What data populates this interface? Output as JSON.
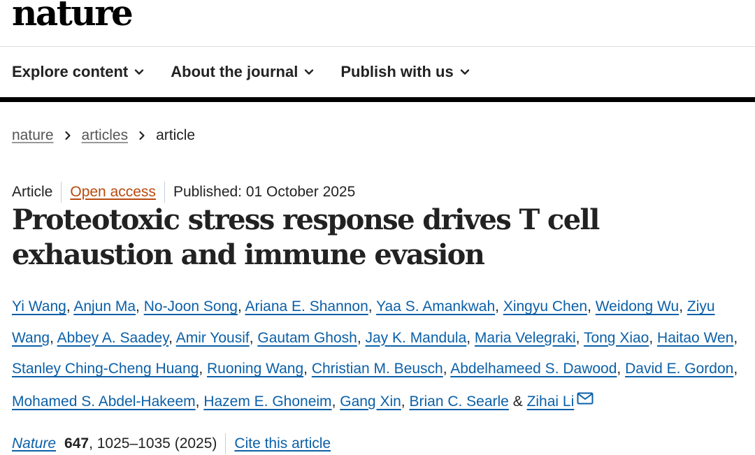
{
  "site": {
    "logo": "nature"
  },
  "nav": {
    "items": [
      {
        "label": "Explore content",
        "icon": "chevron-down-icon"
      },
      {
        "label": "About the journal",
        "icon": "chevron-down-icon"
      },
      {
        "label": "Publish with us",
        "icon": "chevron-down-icon"
      }
    ]
  },
  "breadcrumb": {
    "items": [
      "nature",
      "articles"
    ],
    "current": "article",
    "separator_icon": "chevron-right-icon"
  },
  "article": {
    "type": "Article",
    "access": "Open access",
    "published": "Published: 01 October 2025",
    "title": "Proteotoxic stress response drives T cell exhaustion and immune evasion",
    "authors": [
      "Yi Wang",
      "Anjun Ma",
      "No-Joon Song",
      "Ariana E. Shannon",
      "Yaa S. Amankwah",
      "Xingyu Chen",
      "Weidong Wu",
      "Ziyu Wang",
      "Abbey A. Saadey",
      "Amir Yousif",
      "Gautam Ghosh",
      "Jay K. Mandula",
      "Maria Velegraki",
      "Tong Xiao",
      "Haitao Wen",
      "Stanley Ching-Cheng Huang",
      "Ruoning Wang",
      "Christian M. Beusch",
      "Abdelhameed S. Dawood",
      "David E. Gordon",
      "Mohamed S. Abdel-Hakeem",
      "Hazem E. Ghoneim",
      "Gang Xin",
      "Brian C. Searle",
      "Zihai Li"
    ],
    "author_sep": ", ",
    "last_sep": " & ",
    "corresponding_icon": "mail-icon"
  },
  "citation": {
    "journal": "Nature",
    "volume": "647",
    "pages": ", 1025–1035 (2025)",
    "cite_label": "Cite this article"
  },
  "colors": {
    "link": "#0b60a8",
    "open_access": "#b84a0e",
    "text": "#222222",
    "rule": "#000000"
  }
}
